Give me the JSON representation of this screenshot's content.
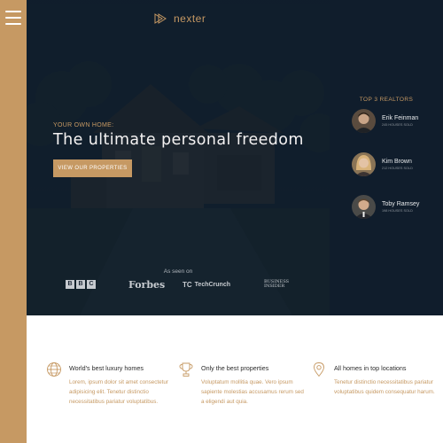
{
  "brand": {
    "name": "nexter",
    "accent": "#c69963",
    "dark": "#101d2c"
  },
  "menu": {
    "icon": "hamburger-menu-icon"
  },
  "hero": {
    "eyebrow": "Your own home:",
    "headline": "The ultimate personal freedom",
    "cta_label": "View our properties",
    "seen_on": "As seen on",
    "press": [
      "BBC",
      "Forbes",
      "TechCrunch",
      "Business Insider"
    ]
  },
  "realtors": {
    "title": "Top 3 Realtors",
    "items": [
      {
        "name": "Erik Feinman",
        "sold": "245 houses sold"
      },
      {
        "name": "Kim Brown",
        "sold": "212 houses sold"
      },
      {
        "name": "Toby Ramsey",
        "sold": "198 houses sold"
      }
    ]
  },
  "features": [
    {
      "icon": "globe-icon",
      "title": "World's best luxury homes",
      "text": "Lorem, ipsum dolor sit amet consectetur adipisicing elit. Tenetur distinctio necessitatibus pariatur voluptatibus."
    },
    {
      "icon": "trophy-icon",
      "title": "Only the best properties",
      "text": "Voluptatum mollitia quae. Vero ipsum sapiente molestias accusamus rerum sed a eligendi aut quia."
    },
    {
      "icon": "map-pin-icon",
      "title": "All homes in top locations",
      "text": "Tenetur distinctio necessitatibus pariatur voluptatibus quidem consequatur harum."
    }
  ]
}
